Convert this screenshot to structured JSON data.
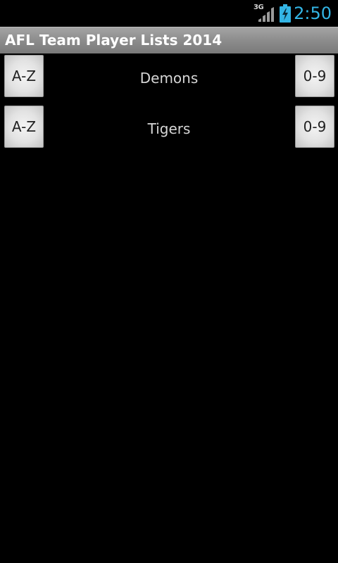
{
  "status_bar": {
    "network": "3G",
    "time": "2:50",
    "signal_icon": "signal-strength-icon",
    "battery_icon": "battery-charging-icon",
    "clock_color": "#33b5e5"
  },
  "app": {
    "title": "AFL Team Player Lists 2014"
  },
  "teams": [
    {
      "name": "Demons",
      "alpha_label": "A-Z",
      "number_label": "0-9"
    },
    {
      "name": "Tigers",
      "alpha_label": "A-Z",
      "number_label": "0-9"
    }
  ]
}
